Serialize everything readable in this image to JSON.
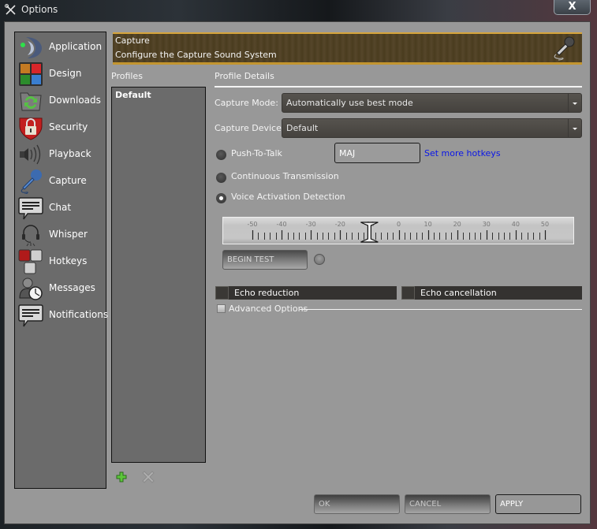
{
  "window": {
    "title": "Options",
    "close_label": "X"
  },
  "sidebar": {
    "items": [
      {
        "label": "Application",
        "icon": "teamspeak-logo-icon"
      },
      {
        "label": "Design",
        "icon": "color-tiles-icon"
      },
      {
        "label": "Downloads",
        "icon": "folder-sync-icon"
      },
      {
        "label": "Security",
        "icon": "shield-lock-icon"
      },
      {
        "label": "Playback",
        "icon": "speaker-icon"
      },
      {
        "label": "Capture",
        "icon": "microphone-icon"
      },
      {
        "label": "Chat",
        "icon": "chat-bubble-icon"
      },
      {
        "label": "Whisper",
        "icon": "headset-icon"
      },
      {
        "label": "Hotkeys",
        "icon": "keys-icon"
      },
      {
        "label": "Messages",
        "icon": "user-clock-icon"
      },
      {
        "label": "Notifications",
        "icon": "notification-bubble-icon"
      }
    ],
    "selected": "Capture"
  },
  "banner": {
    "title": "Capture",
    "subtitle": "Configure the Capture Sound System"
  },
  "profiles": {
    "label": "Profiles",
    "items": [
      "Default"
    ],
    "selected": "Default"
  },
  "details": {
    "label": "Profile Details",
    "capture_mode": {
      "label": "Capture Mode:",
      "value": "Automatically use best mode"
    },
    "capture_device": {
      "label": "Capture Device:",
      "value": "Default"
    },
    "transmission": {
      "options": [
        "Push-To-Talk",
        "Continuous Transmission",
        "Voice Activation Detection"
      ],
      "selected": "Voice Activation Detection"
    },
    "hotkey": {
      "value": "MAJ",
      "link": "Set more hotkeys"
    },
    "vad_slider": {
      "tick_labels": [
        "-50",
        "-40",
        "-30",
        "-20",
        "-10",
        "0",
        "10",
        "20",
        "30",
        "40",
        "50"
      ],
      "min": -50,
      "max": 50,
      "value": -10
    },
    "begin_test_label": "BEGIN TEST",
    "echo_reduction": {
      "label": "Echo reduction",
      "checked": false
    },
    "echo_cancellation": {
      "label": "Echo cancellation",
      "checked": false
    },
    "advanced_options": {
      "label": "Advanced Options",
      "checked": false
    }
  },
  "footer": {
    "ok": "OK",
    "cancel": "CANCEL",
    "apply": "APPLY"
  },
  "colors": {
    "link": "#0a16e8",
    "banner_accent": "#d7a53c",
    "add_green": "#5cc63a"
  }
}
